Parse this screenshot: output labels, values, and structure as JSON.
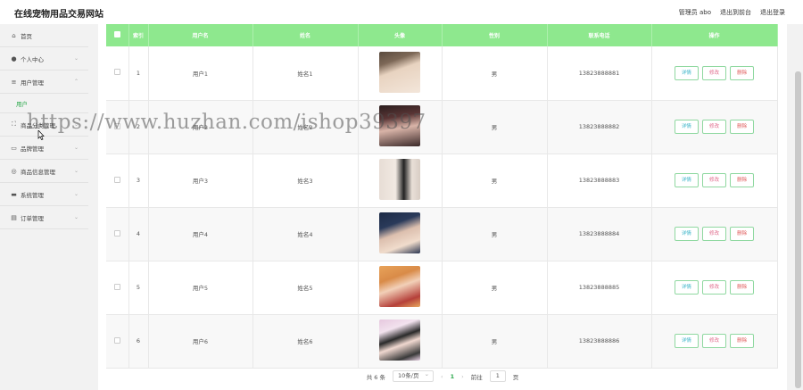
{
  "site_title": "在线宠物用品交易网站",
  "header": {
    "admin_label": "管理员 abo",
    "to_frontend": "退出到前台",
    "logout": "退出登录"
  },
  "sidebar": {
    "items": [
      {
        "label": "首页",
        "icon": "home-icon"
      },
      {
        "label": "个人中心",
        "icon": "user-icon"
      },
      {
        "label": "用户管理",
        "icon": "list-icon"
      },
      {
        "label": "商品分类管理",
        "icon": "grid-icon"
      },
      {
        "label": "品牌管理",
        "icon": "message-icon"
      },
      {
        "label": "商品信息管理",
        "icon": "settings-icon"
      },
      {
        "label": "系统管理",
        "icon": "monitor-icon"
      },
      {
        "label": "订单管理",
        "icon": "doc-icon"
      }
    ],
    "sub_item": "用户"
  },
  "table": {
    "headers": [
      "索引",
      "用户名",
      "姓名",
      "头像",
      "性别",
      "联系电话",
      "操作"
    ],
    "rows": [
      {
        "index": "1",
        "username": "用户1",
        "name": "姓名1",
        "gender": "男",
        "phone": "13823888881"
      },
      {
        "index": "2",
        "username": "用户2",
        "name": "姓名2",
        "gender": "男",
        "phone": "13823888882"
      },
      {
        "index": "3",
        "username": "用户3",
        "name": "姓名3",
        "gender": "男",
        "phone": "13823888883"
      },
      {
        "index": "4",
        "username": "用户4",
        "name": "姓名4",
        "gender": "男",
        "phone": "13823888884"
      },
      {
        "index": "5",
        "username": "用户5",
        "name": "姓名5",
        "gender": "男",
        "phone": "13823888885"
      },
      {
        "index": "6",
        "username": "用户6",
        "name": "姓名6",
        "gender": "男",
        "phone": "13823888886"
      }
    ],
    "actions": {
      "detail": "详情",
      "edit": "修改",
      "delete": "删除"
    }
  },
  "pager": {
    "total": "共 6 条",
    "page_size": "10条/页",
    "prev": "‹",
    "current": "1",
    "next": "›",
    "goto_label": "前往",
    "goto_value": "1",
    "page_suffix": "页"
  },
  "watermark": "https://www.huzhan.com/ishop39397",
  "colors": {
    "header_green": "#8ee88e",
    "accent_green": "#2aa84a"
  }
}
